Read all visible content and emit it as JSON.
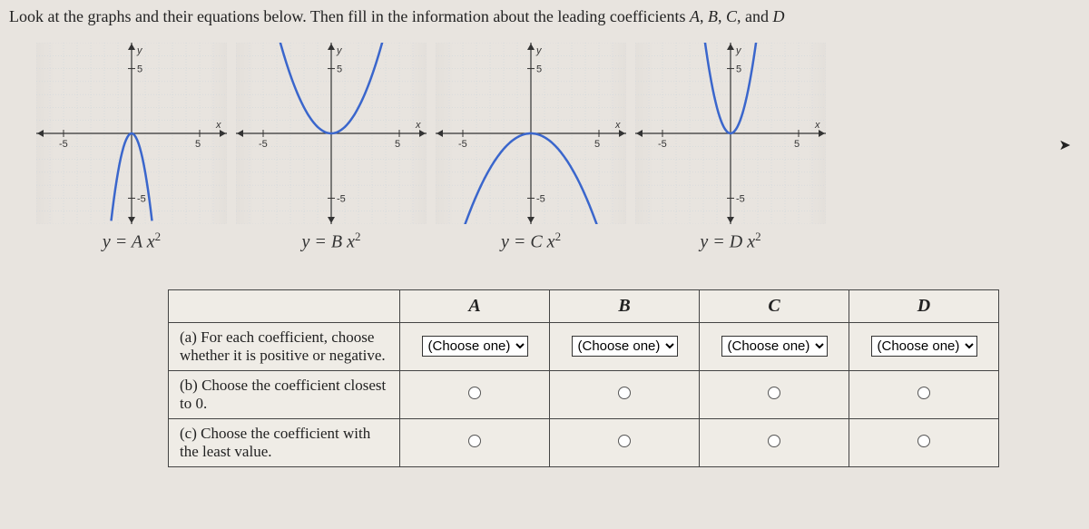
{
  "instruction": {
    "prefix": "Look at the graphs and their equations below. Then fill in the information about the leading coefficients ",
    "vars": [
      "A",
      "B",
      "C",
      "D"
    ],
    "sep": ", ",
    "last_sep": ", and "
  },
  "chart_data": [
    {
      "type": "line",
      "title": "y = A x²",
      "coef": "A",
      "vertex": 0,
      "a": -3.0,
      "xlabel": "x",
      "ylabel": "y",
      "xlim": [
        -7,
        7
      ],
      "ylim": [
        -7,
        7
      ],
      "ticks": [
        -5,
        5
      ]
    },
    {
      "type": "line",
      "title": "y = B x²",
      "coef": "B",
      "vertex": 0,
      "a": 0.5,
      "xlabel": "x",
      "ylabel": "y",
      "xlim": [
        -7,
        7
      ],
      "ylim": [
        -7,
        7
      ],
      "ticks": [
        -5,
        5
      ]
    },
    {
      "type": "line",
      "title": "y = C x²",
      "coef": "C",
      "vertex": 0,
      "a": -0.3,
      "xlabel": "x",
      "ylabel": "y",
      "xlim": [
        -7,
        7
      ],
      "ylim": [
        -7,
        7
      ],
      "ticks": [
        -5,
        5
      ]
    },
    {
      "type": "line",
      "title": "y = D x²",
      "coef": "D",
      "vertex": 0,
      "a": 2.0,
      "xlabel": "x",
      "ylabel": "y",
      "xlim": [
        -7,
        7
      ],
      "ylim": [
        -7,
        7
      ],
      "ticks": [
        -5,
        5
      ]
    }
  ],
  "table": {
    "columns": [
      "A",
      "B",
      "C",
      "D"
    ],
    "rows": [
      {
        "label": "(a) For each coefficient, choose whether it is positive or negative.",
        "control": "select"
      },
      {
        "label": "(b) Choose the coefficient closest to 0.",
        "control": "radio"
      },
      {
        "label": "(c) Choose the coefficient with the least value.",
        "control": "radio"
      }
    ],
    "select_placeholder": "(Choose one)"
  }
}
